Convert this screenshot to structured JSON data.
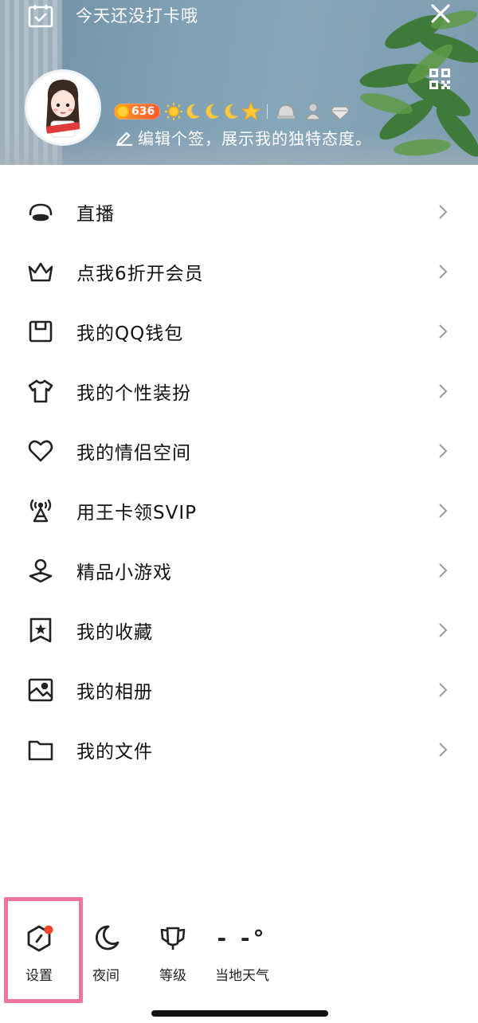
{
  "header": {
    "checkin_text": "今天还没打卡哦",
    "vip_value": "636",
    "signature": "编辑个签，展示我的独特态度。"
  },
  "menu": [
    {
      "name": "live",
      "icon": "live-icon",
      "label": "直播"
    },
    {
      "name": "vip",
      "icon": "crown-icon",
      "label": "点我6折开会员"
    },
    {
      "name": "wallet",
      "icon": "wallet-icon",
      "label": "我的QQ钱包"
    },
    {
      "name": "dressup",
      "icon": "shirt-icon",
      "label": "我的个性装扮"
    },
    {
      "name": "couple",
      "icon": "heart-icon",
      "label": "我的情侣空间"
    },
    {
      "name": "kingcard",
      "icon": "signal-tower-icon",
      "label": "用王卡领SVIP"
    },
    {
      "name": "games",
      "icon": "game-location-icon",
      "label": "精品小游戏"
    },
    {
      "name": "favorites",
      "icon": "bookmark-star-icon",
      "label": "我的收藏"
    },
    {
      "name": "album",
      "icon": "photo-album-icon",
      "label": "我的相册"
    },
    {
      "name": "files",
      "icon": "folder-icon",
      "label": "我的文件"
    }
  ],
  "bottom_bar": {
    "settings": "设置",
    "night": "夜间",
    "level": "等级",
    "weather_label": "当地天气",
    "weather_value": "- -°"
  },
  "colors": {
    "highlight": "#f0739a",
    "notification_dot": "#f2452d",
    "vip_orange": "#ff6a2a"
  }
}
